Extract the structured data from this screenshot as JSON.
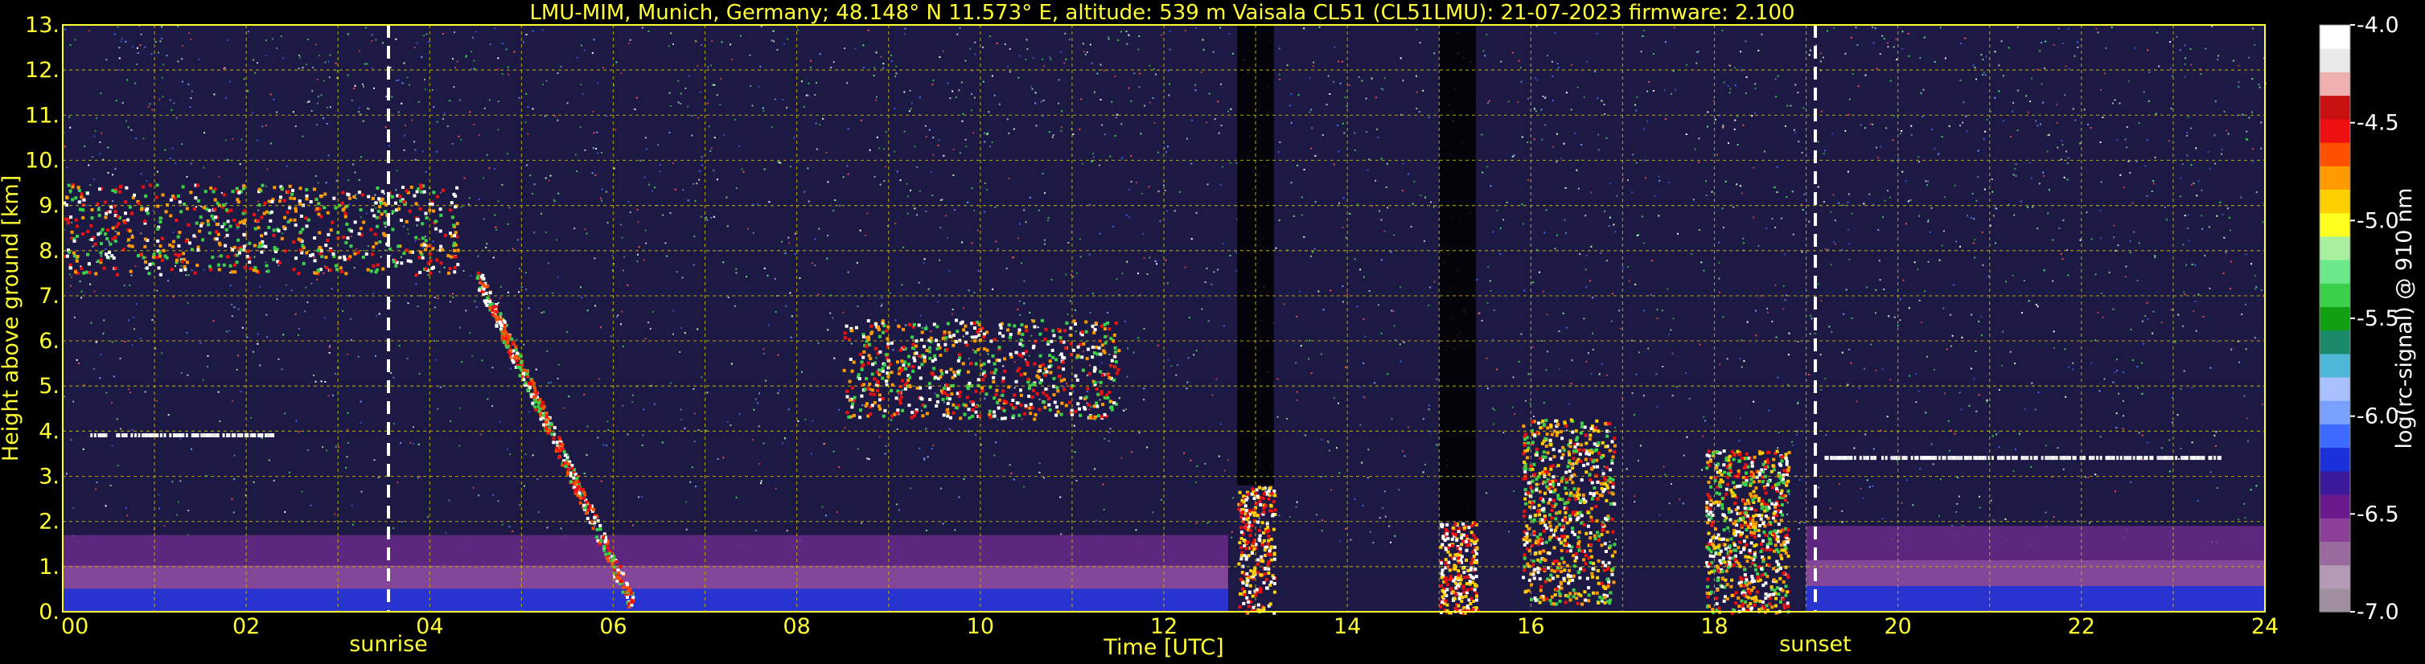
{
  "chart_data": {
    "type": "heatmap",
    "title": "LMU-MIM, Munich, Germany; 48.148° N 11.573° E, altitude: 539 m    Vaisala CL51 (CL51LMU): 21-07-2023    firmware: 2.100",
    "xlabel": "Time [UTC]",
    "ylabel": "Height above ground [km]",
    "xlim": [
      0,
      24
    ],
    "ylim": [
      0,
      13
    ],
    "x_ticks": [
      "00",
      "02",
      "04",
      "06",
      "08",
      "10",
      "12",
      "14",
      "16",
      "18",
      "20",
      "22",
      "24"
    ],
    "y_ticks": [
      "0.",
      "1.",
      "2.",
      "3.",
      "4.",
      "5.",
      "6.",
      "7.",
      "8.",
      "9.",
      "10.",
      "11.",
      "12.",
      "13."
    ],
    "grid": true,
    "colorbar": {
      "label": "log(rc-signal) @ 910 nm",
      "range": [
        -7.0,
        -4.0
      ],
      "ticks": [
        "-4.0",
        "-4.5",
        "-5.0",
        "-5.5",
        "-6.0",
        "-6.5",
        "-7.0"
      ],
      "colors": [
        "#a08fa0",
        "#b59ab5",
        "#9a6a9f",
        "#8c3f98",
        "#6a1a8a",
        "#3a1a9a",
        "#1a30d8",
        "#3f6aff",
        "#7aa0ff",
        "#a8c0ff",
        "#4fb8d8",
        "#1a8a6a",
        "#11a011",
        "#3ad04a",
        "#6ae88a",
        "#a8f0a0",
        "#ffff20",
        "#ffd000",
        "#ff9a00",
        "#ff5000",
        "#ee1010",
        "#c81010",
        "#f0b0b0",
        "#e8e8e8",
        "#ffffff"
      ]
    },
    "markers": [
      {
        "label": "sunrise",
        "x": 3.55
      },
      {
        "label": "sunset",
        "x": 19.1
      }
    ],
    "features": [
      {
        "kind": "boundary-layer",
        "x0": 0,
        "x1": 12.7,
        "top_km": 1.7
      },
      {
        "kind": "cirrus",
        "x0": 0,
        "x1": 4.3,
        "base_km": 7.5,
        "top_km": 9.5
      },
      {
        "kind": "cloud-layer",
        "x0": 0.3,
        "x1": 2.3,
        "height_km": 3.9
      },
      {
        "kind": "cloud-descending",
        "x0": 4.5,
        "x1": 6.2,
        "from_km": 7.5,
        "to_km": 0.2
      },
      {
        "kind": "cloud-band",
        "x0": 8.5,
        "x1": 11.5,
        "base_km": 4.3,
        "top_km": 6.5
      },
      {
        "kind": "rain",
        "x0": 12.8,
        "x1": 13.2,
        "top_km": 2.8
      },
      {
        "kind": "rain",
        "x0": 15.0,
        "x1": 15.4,
        "top_km": 2.0
      },
      {
        "kind": "convective-cloud",
        "x0": 15.9,
        "x1": 16.9,
        "base_km": 0.2,
        "top_km": 4.3
      },
      {
        "kind": "convective-cloud",
        "x0": 17.9,
        "x1": 18.8,
        "base_km": 0.0,
        "top_km": 3.6
      },
      {
        "kind": "cloud-layer",
        "x0": 19.2,
        "x1": 23.5,
        "height_km": 3.4
      },
      {
        "kind": "boundary-layer",
        "x0": 19.0,
        "x1": 24,
        "top_km": 1.9
      }
    ]
  }
}
